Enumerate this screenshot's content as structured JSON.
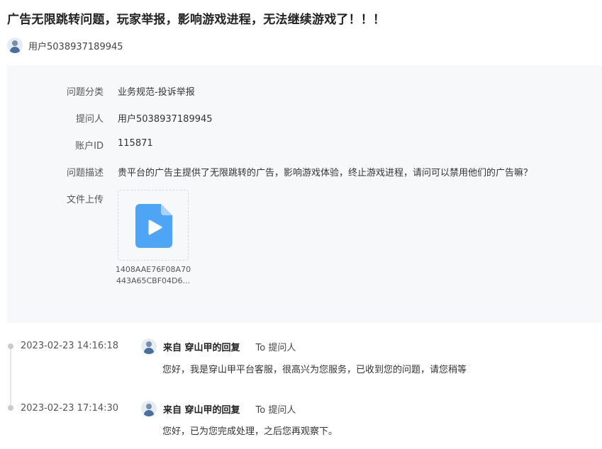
{
  "question": {
    "title": "广告无限跳转问题，玩家举报，影响游戏进程，无法继续游戏了！！！",
    "author": "用户5038937189945"
  },
  "details": {
    "category": {
      "label": "问题分类",
      "value": "业务规范-投诉举报"
    },
    "asker": {
      "label": "提问人",
      "value": "用户5038937189945"
    },
    "account": {
      "label": "账户ID",
      "value": "115871"
    },
    "description": {
      "label": "问题描述",
      "value": "贵平台的广告主提供了无限跳转的广告，影响游戏体验，终止游戏进程，请问可以禁用他们的广告嘛？"
    },
    "upload": {
      "label": "文件上传",
      "file_icon": "video-file-icon",
      "file_name_line1": "1408AAE76F08A70",
      "file_name_line2": "443A65CBF04D6..."
    }
  },
  "replies": [
    {
      "time": "2023-02-23 14:16:18",
      "from": "来自 穿山甲的回复",
      "to": "To 提问人",
      "text": "您好，我是穿山甲平台客服，很高兴为您服务，已收到您的问题，请您稍等"
    },
    {
      "time": "2023-02-23 17:14:30",
      "from": "来自 穿山甲的回复",
      "to": "To 提问人",
      "text": "您好，已为您完成处理，之后您再观察下。"
    }
  ],
  "colors": {
    "panel_bg": "#f7f8fa",
    "file_icon": "#4ea5f5",
    "timeline": "#c8ccd2"
  }
}
